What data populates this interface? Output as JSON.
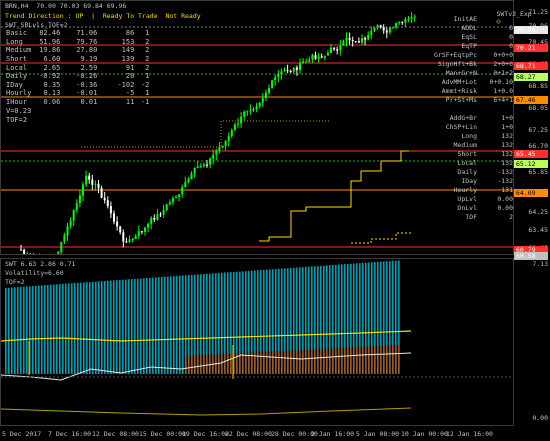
{
  "header": {
    "symbol_line": "BRN,H4  70.00 70.03 69.84 69.96",
    "ea_name": "SWTv3_Exp",
    "ea_face": "☺",
    "status_line": "Trend Direction : UP  |  Ready To Trade  Not Ready",
    "sub_line": "SWT_SRLvls_TOF=2"
  },
  "stats_table": {
    "rows": [
      [
        "Basic",
        "82.46",
        "71.06",
        "86",
        "1"
      ],
      [
        "Long",
        "51.96",
        "79.76",
        "153",
        "2"
      ],
      [
        "Medium",
        "19.86",
        "27.80",
        "149",
        "2"
      ],
      [
        "Short",
        "6.60",
        "9.19",
        "139",
        "2"
      ],
      [
        "Local",
        "2.65",
        "2.59",
        "91",
        "2"
      ],
      [
        "Daily",
        "-0.92",
        "-0.26",
        "28",
        "1"
      ],
      [
        "IDay",
        "0.35",
        "-0.36",
        "-102",
        "-2"
      ],
      [
        "Hourly",
        "0.13",
        "-0.01",
        "-5",
        "1"
      ],
      [
        "IHour",
        "0.06",
        "0.01",
        "11",
        "-1"
      ]
    ],
    "v_line": "V=0.23",
    "tof_line": "TOF=2"
  },
  "right_list": [
    "InitAE",
    "ADDL",
    "EqSL",
    "EqTP",
    "GrSF+EqtpPc",
    "SignHft+Bk",
    "Man+Gr+N",
    "AdvMM+Lot",
    "Ammt+Risk",
    "Pr+St+Ms",
    "",
    "AddG+Br",
    "ChSP+Lin",
    "Long",
    "Medium",
    "Short",
    "Local",
    "Daily",
    "IDay",
    "Hourly",
    "UpLvl",
    "DnLvl",
    "TOF"
  ],
  "right_values": [
    "",
    "0",
    "0",
    "0",
    "0+0+0",
    "2+0+0",
    "0+1+2",
    "0+0.10",
    "1+0.0",
    "6+4+1",
    "",
    "1+0",
    "1+0",
    "132",
    "132",
    "132",
    "132",
    "-132",
    "-132",
    "131",
    "0.00",
    "0.00",
    "2"
  ],
  "price_scale": {
    "labels": [
      "71.25",
      "70.96",
      "70.45",
      "69.65",
      "68.85",
      "68.05",
      "67.25",
      "66.70",
      "65.85",
      "65.05",
      "64.25",
      "63.45",
      "62.65",
      "61.85",
      "61.05",
      "60.85"
    ],
    "tags": [
      {
        "text": "70.96",
        "color": "#ffffff",
        "bg": "#e8e8e8"
      },
      {
        "text": "70.21",
        "color": "#ffffff",
        "bg": "#ff3030"
      },
      {
        "text": "68.71",
        "color": "#ffffff",
        "bg": "#ff3030"
      },
      {
        "text": "68.27",
        "color": "#000000",
        "bg": "#b8ff60"
      },
      {
        "text": "67.46",
        "color": "#000000",
        "bg": "#ff8c00"
      },
      {
        "text": "65.45",
        "color": "#ffffff",
        "bg": "#ff3030"
      },
      {
        "text": "65.12",
        "color": "#000000",
        "bg": "#b8ff60"
      },
      {
        "text": "64.09",
        "color": "#000000",
        "bg": "#ff8c00"
      },
      {
        "text": "60.79",
        "color": "#ffffff",
        "bg": "#ff3030"
      },
      {
        "text": "60.58",
        "color": "#ffffff",
        "bg": "#c0c0c0"
      }
    ]
  },
  "indicator": {
    "title": "SWT 6.63 2.86 0.71",
    "volatility": "Volatility=6.60",
    "tof": "TOF=2",
    "scale_labels": [
      "7.13",
      "0.00"
    ]
  },
  "time_axis": [
    "5 Dec 2017",
    "7 Dec 16:00",
    "12 Dec 08:00",
    "15 Dec 00:00",
    "19 Dec 16:00",
    "22 Dec 08:00",
    "28 Dec 00:00",
    "2 Jan 16:00",
    "5 Jan 08:00",
    "10 Jan 00:00",
    "12 Jan 16:00"
  ],
  "colors": {
    "candle_up": "#00ff00",
    "candle_down": "#ffffff",
    "level_red": "#ff3030",
    "level_orange": "#ff8c00",
    "level_yellow": "#ffd700",
    "dotted_green": "#1eb41e",
    "histogram_cyan": "#00bcd4"
  }
}
